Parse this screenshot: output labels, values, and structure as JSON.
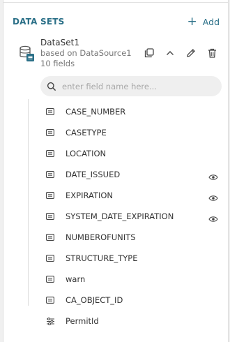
{
  "section": {
    "title": "DATA SETS",
    "add_label": "Add"
  },
  "dataset": {
    "name": "DataSet1",
    "source": "based on DataSource1",
    "field_count": "10 fields"
  },
  "search": {
    "placeholder": "enter field name here...",
    "value": ""
  },
  "fields": [
    {
      "label": "CASE_NUMBER",
      "icon": "text-field-icon",
      "eye": false
    },
    {
      "label": "CASETYPE",
      "icon": "text-field-icon",
      "eye": false
    },
    {
      "label": "LOCATION",
      "icon": "text-field-icon",
      "eye": false
    },
    {
      "label": "DATE_ISSUED",
      "icon": "text-field-icon",
      "eye": true
    },
    {
      "label": "EXPIRATION",
      "icon": "text-field-icon",
      "eye": true
    },
    {
      "label": "SYSTEM_DATE_EXPIRATION",
      "icon": "text-field-icon",
      "eye": true
    },
    {
      "label": "NUMBEROFUNITS",
      "icon": "text-field-icon",
      "eye": false
    },
    {
      "label": "STRUCTURE_TYPE",
      "icon": "text-field-icon",
      "eye": false
    },
    {
      "label": "warn",
      "icon": "text-field-icon",
      "eye": false
    },
    {
      "label": "CA_OBJECT_ID",
      "icon": "text-field-icon",
      "eye": false
    },
    {
      "label": "PermitId",
      "icon": "computed-field-icon",
      "eye": false
    }
  ],
  "colors": {
    "accent": "#2a6f87",
    "icon": "#555555",
    "muted": "#777777"
  }
}
